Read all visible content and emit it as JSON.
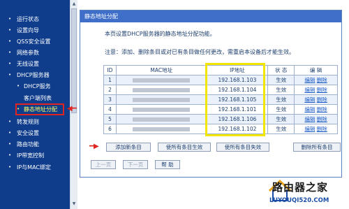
{
  "sidebar": {
    "items": [
      {
        "label": "运行状态",
        "sub": false,
        "active": false
      },
      {
        "label": "设置向导",
        "sub": false,
        "active": false
      },
      {
        "label": "QSS安全设置",
        "sub": false,
        "active": false
      },
      {
        "label": "网络参数",
        "sub": false,
        "active": false
      },
      {
        "label": "无线设置",
        "sub": false,
        "active": false
      },
      {
        "label": "DHCP服务器",
        "sub": false,
        "active": false
      },
      {
        "label": "DHCP服务",
        "sub": true,
        "active": false
      },
      {
        "label": "客户端列表",
        "sub": true,
        "active": false
      },
      {
        "label": "静态地址分配",
        "sub": true,
        "active": true
      },
      {
        "label": "转发规则",
        "sub": false,
        "active": false
      },
      {
        "label": "安全设置",
        "sub": false,
        "active": false
      },
      {
        "label": "路由功能",
        "sub": false,
        "active": false
      },
      {
        "label": "IP带宽控制",
        "sub": false,
        "active": false
      },
      {
        "label": "IP与MAC绑定",
        "sub": false,
        "active": false
      }
    ]
  },
  "panel": {
    "title": "静态地址分配",
    "description": "本页设置DHCP服务器的静态地址分配功能。",
    "note": "注意：添加、删除条目或对已有条目做任何更改，需重启本设备后才能生效。"
  },
  "table": {
    "headers": {
      "id": "ID",
      "mac": "MAC地址",
      "ip": "IP地址",
      "status": "状 态",
      "edit": "编 辑"
    },
    "rows": [
      {
        "id": "1",
        "ip": "192.168.1.103",
        "status": "生效",
        "edit": "编辑",
        "delete": "删除"
      },
      {
        "id": "2",
        "ip": "192.168.1.104",
        "status": "生效",
        "edit": "编辑",
        "delete": "删除"
      },
      {
        "id": "3",
        "ip": "192.168.1.105",
        "status": "生效",
        "edit": "编辑",
        "delete": "删除"
      },
      {
        "id": "4",
        "ip": "192.168.1.101",
        "status": "生效",
        "edit": "编辑",
        "delete": "删除"
      },
      {
        "id": "5",
        "ip": "192.168.1.106",
        "status": "生效",
        "edit": "编辑",
        "delete": "删除"
      },
      {
        "id": "6",
        "ip": "192.168.1.102",
        "status": "生效",
        "edit": "编辑",
        "delete": "删除"
      }
    ]
  },
  "actions": {
    "add": "添加新条目",
    "enable_all": "使所有条目生效",
    "disable_all": "使所有条目失效",
    "delete_all": "删除所有条目"
  },
  "pager": {
    "prev": "上一页",
    "next": "下一页",
    "help": "帮 助"
  },
  "watermark": {
    "title": "路由器之家",
    "url": "LUYOUQI520.COM"
  },
  "colors": {
    "sidebar_bg": "#0f3d8c",
    "header_bg": "#3f6fc9",
    "highlight_yellow": "#f2e600",
    "annotation_red": "#e0241f",
    "link_blue": "#1b5bc6"
  }
}
